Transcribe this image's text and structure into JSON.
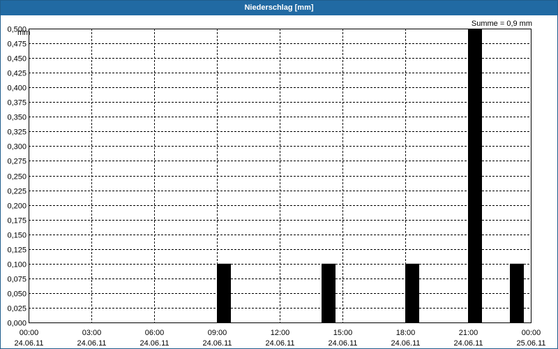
{
  "window": {
    "title": "Niederschlag [mm]"
  },
  "chart_data": {
    "type": "bar",
    "title": "Niederschlag [mm]",
    "ylabel": "mm",
    "annotation": "Summe = 0,9 mm",
    "ylim": [
      0,
      0.5
    ],
    "yticks": [
      "0,000",
      "0,025",
      "0,050",
      "0,075",
      "0,100",
      "0,125",
      "0,150",
      "0,175",
      "0,200",
      "0,225",
      "0,250",
      "0,275",
      "0,300",
      "0,325",
      "0,350",
      "0,375",
      "0,400",
      "0,425",
      "0,450",
      "0,475",
      "0,500"
    ],
    "xlim": [
      "24.06.11 00:00",
      "25.06.11 00:00"
    ],
    "xticks": [
      {
        "time": "00:00",
        "date": "24.06.11"
      },
      {
        "time": "03:00",
        "date": "24.06.11"
      },
      {
        "time": "06:00",
        "date": "24.06.11"
      },
      {
        "time": "09:00",
        "date": "24.06.11"
      },
      {
        "time": "12:00",
        "date": "24.06.11"
      },
      {
        "time": "15:00",
        "date": "24.06.11"
      },
      {
        "time": "18:00",
        "date": "24.06.11"
      },
      {
        "time": "21:00",
        "date": "24.06.11"
      },
      {
        "time": "00:00",
        "date": "25.06.11"
      }
    ],
    "bars": [
      {
        "start": "24.06.11 09:00",
        "end": "24.06.11 09:40",
        "value": 0.1
      },
      {
        "start": "24.06.11 14:00",
        "end": "24.06.11 14:40",
        "value": 0.1
      },
      {
        "start": "24.06.11 18:00",
        "end": "24.06.11 18:40",
        "value": 0.1
      },
      {
        "start": "24.06.11 21:00",
        "end": "24.06.11 21:40",
        "value": 0.5
      },
      {
        "start": "24.06.11 23:00",
        "end": "24.06.11 23:40",
        "value": 0.1
      }
    ],
    "grid": true,
    "legend": "none",
    "colors": {
      "bar": "#000000",
      "grid": "#000000",
      "title_bar": "#216aa3"
    }
  }
}
